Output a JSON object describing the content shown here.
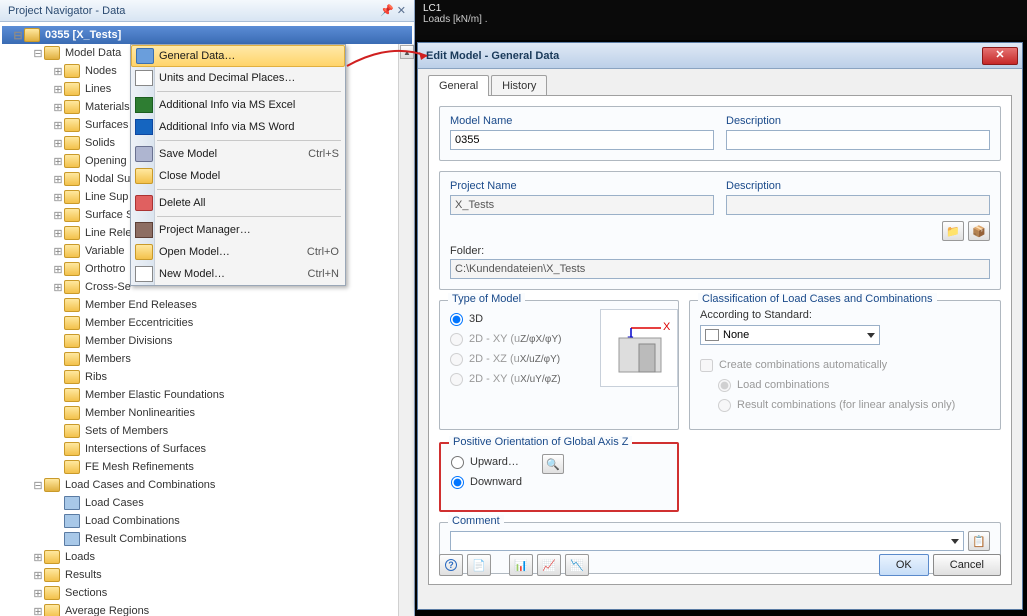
{
  "navigator": {
    "title": "Project Navigator - Data",
    "root": "0355 [X_Tests]",
    "model_data": "Model Data",
    "items1": [
      "Nodes",
      "Lines",
      "Materials",
      "Surfaces",
      "Solids",
      "Opening",
      "Nodal Su",
      "Line Sup",
      "Surface S",
      "Line Rele",
      "Variable",
      "Orthotro",
      "Cross-Se"
    ],
    "items2": [
      "Member End Releases",
      "Member Eccentricities",
      "Member Divisions",
      "Members",
      "Ribs",
      "Member Elastic Foundations",
      "Member Nonlinearities",
      "Sets of Members",
      "Intersections of Surfaces",
      "FE Mesh Refinements"
    ],
    "lcc": "Load Cases and Combinations",
    "lcc_items": [
      "Load Cases",
      "Load Combinations",
      "Result Combinations"
    ],
    "tail": [
      "Loads",
      "Results",
      "Sections",
      "Average Regions"
    ]
  },
  "context_menu": {
    "general_data": "General Data…",
    "units": "Units and Decimal Places…",
    "excel": "Additional Info via MS Excel",
    "word": "Additional Info via MS Word",
    "save": "Save Model",
    "save_sc": "Ctrl+S",
    "close": "Close Model",
    "delete": "Delete All",
    "pm": "Project Manager…",
    "open": "Open Model…",
    "open_sc": "Ctrl+O",
    "new": "New Model…",
    "new_sc": "Ctrl+N"
  },
  "canvas": {
    "lc": "LC1",
    "loads": "Loads [kN/m] ."
  },
  "dialog": {
    "title": "Edit Model - General Data",
    "tabs": {
      "general": "General",
      "history": "History"
    },
    "model_name_lbl": "Model Name",
    "model_name_val": "0355",
    "desc_lbl": "Description",
    "project_name_lbl": "Project Name",
    "project_name_val": "X_Tests",
    "folder_lbl": "Folder:",
    "folder_val": "C:\\Kundendateien\\X_Tests",
    "type_legend": "Type of Model",
    "type_3d": "3D",
    "type_xy": "2D - XY (u",
    "type_xy_sub": "Z/φX/φY)",
    "type_xz": "2D - XZ (u",
    "type_xz_sub": "X/uZ/φY)",
    "type_xy2": "2D - XY (u",
    "type_xy2_sub": "X/uY/φZ)",
    "class_legend": "Classification of Load Cases and Combinations",
    "acc_lbl": "According to Standard:",
    "acc_val": "None",
    "chk_auto": "Create combinations automatically",
    "r_load": "Load combinations",
    "r_result": "Result combinations (for linear analysis only)",
    "axis_legend": "Positive Orientation of Global Axis Z",
    "axis_up": "Upward…",
    "axis_down": "Downward",
    "comment_legend": "Comment",
    "ok": "OK",
    "cancel": "Cancel"
  }
}
